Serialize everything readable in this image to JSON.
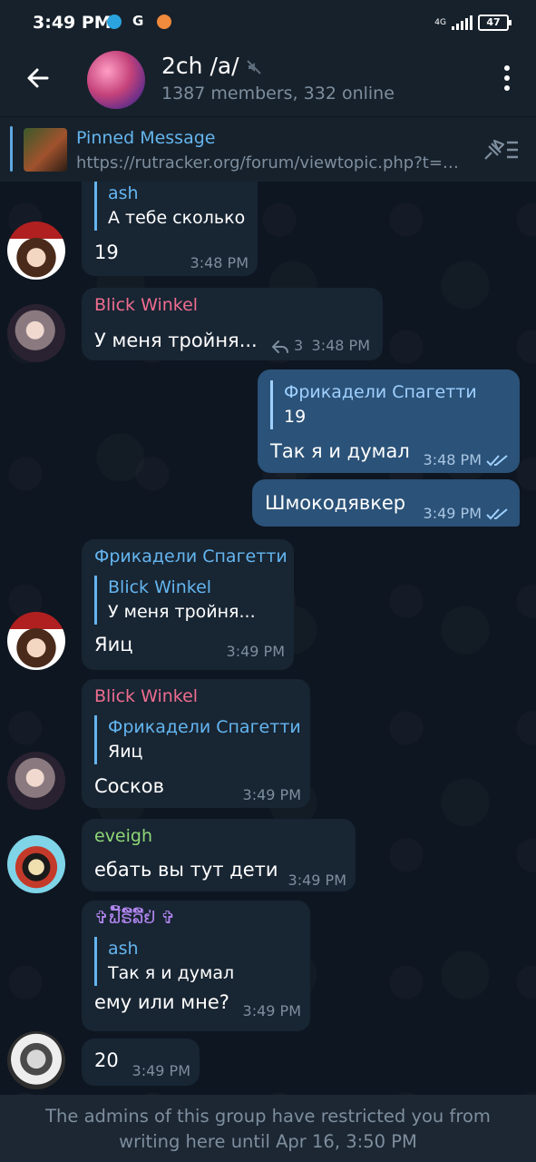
{
  "status_bar": {
    "time": "3:49 PM",
    "network": "4G",
    "battery": "47"
  },
  "header": {
    "title": "2ch /a/",
    "subtitle": "1387 members, 332 online"
  },
  "pinned": {
    "title": "Pinned Message",
    "text": "https://rutracker.org/forum/viewtopic.php?t=…"
  },
  "messages": [
    {
      "reply_name": "ash",
      "reply_text": "А тебе сколько",
      "text": "19",
      "time": "3:48 PM"
    },
    {
      "sender": "Blick Winkel",
      "text": "У меня тройня...",
      "replies": "3",
      "time": "3:48 PM"
    },
    {
      "reply_name": "Фрикадели Спагетти",
      "reply_text": "19",
      "text": "Так я и думал",
      "time": "3:48 PM"
    },
    {
      "text": "Шмокодявкер",
      "time": "3:49 PM"
    },
    {
      "sender": "Фрикадели Спагетти",
      "reply_name": "Blick Winkel",
      "reply_text": "У меня тройня...",
      "text": "Яиц",
      "time": "3:49 PM"
    },
    {
      "sender": "Blick Winkel",
      "reply_name": "Фрикадели Спагетти",
      "reply_text": "Яиц",
      "text": "Сосков",
      "time": "3:49 PM"
    },
    {
      "sender": "eveigh",
      "text": "ебать вы тут дети",
      "time": "3:49 PM"
    },
    {
      "sender": "✞ຟ້ັ້ັ້ີ້ຣ໌ີ້ລ໌ີ້ຢ່ ✞",
      "reply_name": "ash",
      "reply_text": "Так я и думал",
      "text": "ему или мне?",
      "time": "3:49 PM"
    },
    {
      "text": "20",
      "time": "3:49 PM"
    }
  ],
  "footer": {
    "notice": "The admins of this group have restricted you from writing here until Apr 16, 3:50 PM"
  },
  "colors": {
    "pink_name": "#ee6d8f",
    "blue_name": "#64b5ef",
    "green_name": "#8fd878",
    "purple_name": "#b286f0"
  }
}
